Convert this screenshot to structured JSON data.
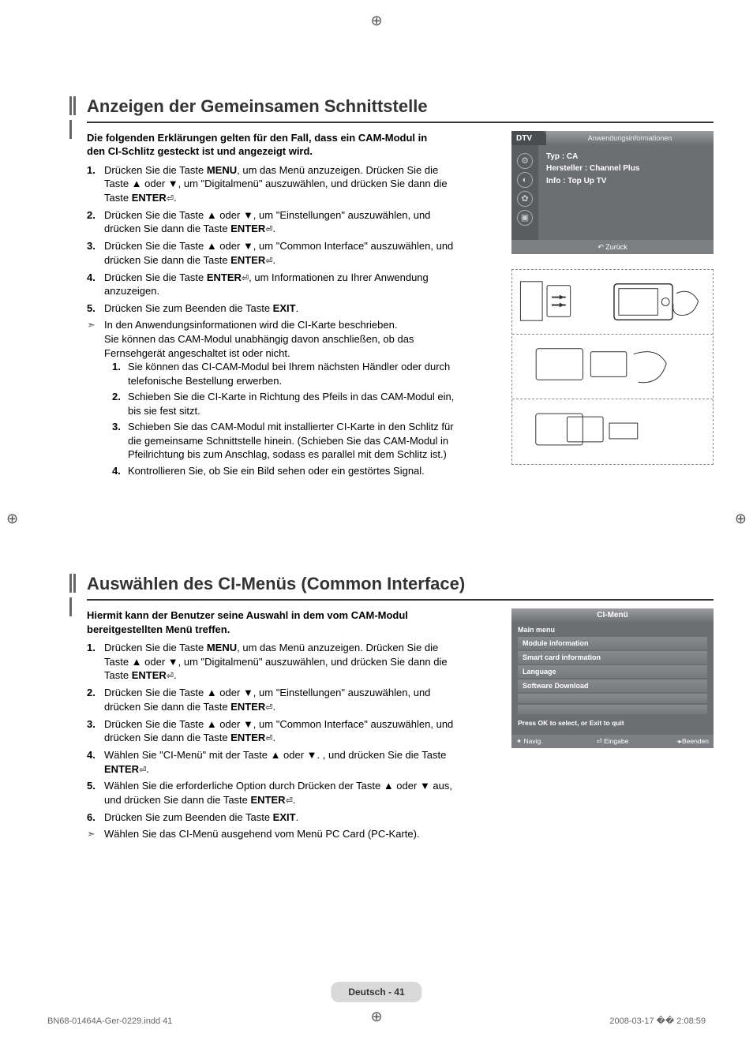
{
  "reg_glyph": "⊕",
  "section1": {
    "heading": "Anzeigen der Gemeinsamen Schnittstelle",
    "intro": "Die folgenden Erklärungen gelten für den Fall, dass ein CAM-Modul in den CI-Schlitz gesteckt ist und angezeigt wird.",
    "steps": {
      "s1_a": "Drücken Sie die Taste ",
      "s1_b": "MENU",
      "s1_c": ", um das Menü anzuzeigen. Drücken Sie die Taste ▲ oder ▼, um \"Digitalmenü\" auszuwählen, und drücken Sie dann die Taste ",
      "s1_d": "ENTER",
      "s2_a": "Drücken Sie die Taste ▲ oder ▼, um \"Einstellungen\" auszuwählen, und drücken Sie dann die Taste ",
      "s2_b": "ENTER",
      "s3_a": "Drücken Sie die Taste ▲ oder ▼, um \"Common Interface\" auszuwählen, und drücken Sie dann die Taste ",
      "s3_b": "ENTER",
      "s4_a": "Drücken Sie die Taste ",
      "s4_b": "ENTER",
      "s4_c": ", um Informationen zu Ihrer Anwendung anzuzeigen.",
      "s5_a": "Drücken Sie zum Beenden die Taste ",
      "s5_b": "EXIT"
    },
    "note": {
      "p1": "In den Anwendungsinformationen wird die CI-Karte beschrieben.",
      "p2": "Sie können das CAM-Modul unabhängig davon anschließen, ob das Fernsehgerät angeschaltet ist oder nicht.",
      "sub1": "Sie können das CI-CAM-Modul bei Ihrem nächsten Händler oder durch telefonische Bestellung erwerben.",
      "sub2": "Schieben Sie die CI-Karte in Richtung des Pfeils in das CAM-Modul ein, bis sie fest sitzt.",
      "sub3": "Schieben Sie das CAM-Modul mit installierter CI-Karte in den Schlitz für die gemeinsame Schnittstelle hinein. (Schieben Sie das CAM-Modul in Pfeilrichtung bis zum Anschlag, sodass es parallel mit dem Schlitz ist.)",
      "sub4": "Kontrollieren Sie, ob Sie ein Bild sehen oder ein gestörtes Signal."
    }
  },
  "panel1": {
    "tab": "DTV",
    "header": "Anwendungsinformationen",
    "type": "Typ : CA",
    "maker": "Hersteller : Channel Plus",
    "info": "Info : Top Up TV",
    "back": "↶ Zurück"
  },
  "section2": {
    "heading": "Auswählen des CI-Menüs (Common Interface)",
    "intro": "Hiermit kann der Benutzer seine Auswahl in dem vom CAM-Modul bereitgestellten Menü treffen.",
    "steps": {
      "s1_a": "Drücken Sie die Taste ",
      "s1_b": "MENU",
      "s1_c": ", um das Menü anzuzeigen. Drücken Sie die Taste ▲ oder ▼, um \"Digitalmenü\" auszuwählen, und drücken Sie dann die Taste ",
      "s1_d": "ENTER",
      "s2_a": "Drücken Sie die Taste ▲ oder ▼, um \"Einstellungen\" auszuwählen, und drücken Sie dann die Taste ",
      "s2_b": "ENTER",
      "s3_a": "Drücken Sie die Taste ▲ oder ▼, um \"Common Interface\" auszuwählen, und drücken Sie dann die Taste ",
      "s3_b": "ENTER",
      "s4_a": "Wählen Sie \"CI-Menü\" mit der Taste ▲ oder ▼. , und drücken Sie die Taste ",
      "s4_b": "ENTER",
      "s5_a": "Wählen Sie die erforderliche Option durch Drücken der Taste ▲ oder ▼ aus, und drücken Sie dann die Taste ",
      "s5_b": "ENTER",
      "s6_a": "Drücken Sie zum Beenden die Taste ",
      "s6_b": "EXIT"
    },
    "note": "Wählen Sie das CI-Menü ausgehend vom Menü PC Card (PC-Karte)."
  },
  "panel3": {
    "header": "CI-Menü",
    "main": "Main menu",
    "items": [
      "Module information",
      "Smart card information",
      "Language",
      "Software Download"
    ],
    "hint": "Press OK to select, or Exit to quit",
    "nav": "✦ Navig.",
    "enter": "⏎ Eingabe",
    "exit": "-▸Beenden"
  },
  "footer": "Deutsch - 41",
  "meta": {
    "file": "BN68-01464A-Ger-0229.indd   41",
    "date": "2008-03-17   �� 2:08:59"
  },
  "enter_icon": "⏎",
  "nums": {
    "n1": "1.",
    "n2": "2.",
    "n3": "3.",
    "n4": "4.",
    "n5": "5.",
    "n6": "6."
  },
  "period": "."
}
